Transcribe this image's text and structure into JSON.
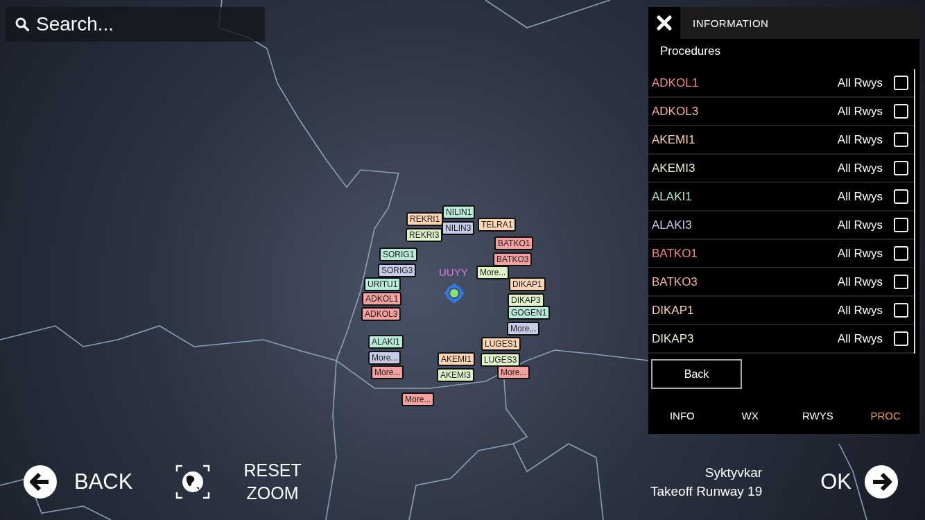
{
  "search": {
    "placeholder": "Search..."
  },
  "map": {
    "airport": "UUYY",
    "labels": [
      {
        "text": "REKRI1",
        "color": "#fcd5b5"
      },
      {
        "text": "NILIN1",
        "color": "#b8ecd8"
      },
      {
        "text": "NILIN3",
        "color": "#c8cce8"
      },
      {
        "text": "TELRA1",
        "color": "#fcd5b5"
      },
      {
        "text": "REKRI3",
        "color": "#e2f2c8"
      },
      {
        "text": "BATKO1",
        "color": "#f6a0a0"
      },
      {
        "text": "SORIG1",
        "color": "#b8ecd8"
      },
      {
        "text": "BATKO3",
        "color": "#f6a0a0"
      },
      {
        "text": "SORIG3",
        "color": "#c8cce8"
      },
      {
        "text": "More...",
        "color": "#e2f2c8"
      },
      {
        "text": "DIKAP1",
        "color": "#fcd5b5"
      },
      {
        "text": "URITU1",
        "color": "#b8ecd8"
      },
      {
        "text": "ADKOL1",
        "color": "#f6a0a0"
      },
      {
        "text": "DIKAP3",
        "color": "#e2f2c8"
      },
      {
        "text": "GOGEN1",
        "color": "#b8ecd8"
      },
      {
        "text": "ADKOL3",
        "color": "#f6a0a0"
      },
      {
        "text": "More...",
        "color": "#c8cce8"
      },
      {
        "text": "ALAKI1",
        "color": "#b8ecd8"
      },
      {
        "text": "LUGES1",
        "color": "#fcd5b5"
      },
      {
        "text": "More...",
        "color": "#c8cce8"
      },
      {
        "text": "AKEMI1",
        "color": "#fcd5b5"
      },
      {
        "text": "LUGES3",
        "color": "#e2f2c8"
      },
      {
        "text": "More...",
        "color": "#f6a0a0"
      },
      {
        "text": "More...",
        "color": "#f6a0a0"
      },
      {
        "text": "AKEMI3",
        "color": "#e2f2c8"
      },
      {
        "text": "More...",
        "color": "#f6a0a0"
      }
    ]
  },
  "panel": {
    "title": "INFORMATION",
    "section": "Procedures",
    "procedures": [
      {
        "name": "ADKOL1",
        "runways": "All Rwys",
        "checked": false,
        "color": "#f08888"
      },
      {
        "name": "ADKOL3",
        "runways": "All Rwys",
        "checked": false,
        "color": "#f4b0a0"
      },
      {
        "name": "AKEMI1",
        "runways": "All Rwys",
        "checked": false,
        "color": "#f8d0b0"
      },
      {
        "name": "AKEMI3",
        "runways": "All Rwys",
        "checked": false,
        "color": "#e4f0c8"
      },
      {
        "name": "ALAKI1",
        "runways": "All Rwys",
        "checked": false,
        "color": "#b0e8d0"
      },
      {
        "name": "ALAKI3",
        "runways": "All Rwys",
        "checked": false,
        "color": "#c8cce8"
      },
      {
        "name": "BATKO1",
        "runways": "All Rwys",
        "checked": false,
        "color": "#f08888"
      },
      {
        "name": "BATKO3",
        "runways": "All Rwys",
        "checked": false,
        "color": "#f4b0a0"
      },
      {
        "name": "DIKAP1",
        "runways": "All Rwys",
        "checked": false,
        "color": "#f8d0b0"
      },
      {
        "name": "DIKAP3",
        "runways": "All Rwys",
        "checked": false,
        "color": "#e4f0c8"
      }
    ],
    "back": "Back",
    "tabs": [
      {
        "label": "INFO",
        "selected": false
      },
      {
        "label": "WX",
        "selected": false
      },
      {
        "label": "RWYS",
        "selected": false
      },
      {
        "label": "PROC",
        "selected": true
      }
    ]
  },
  "bottom": {
    "back": "BACK",
    "reset_zoom": [
      "RESET",
      "ZOOM"
    ],
    "location": "Syktyvkar",
    "departure": "Takeoff Runway 19",
    "ok": "OK"
  }
}
